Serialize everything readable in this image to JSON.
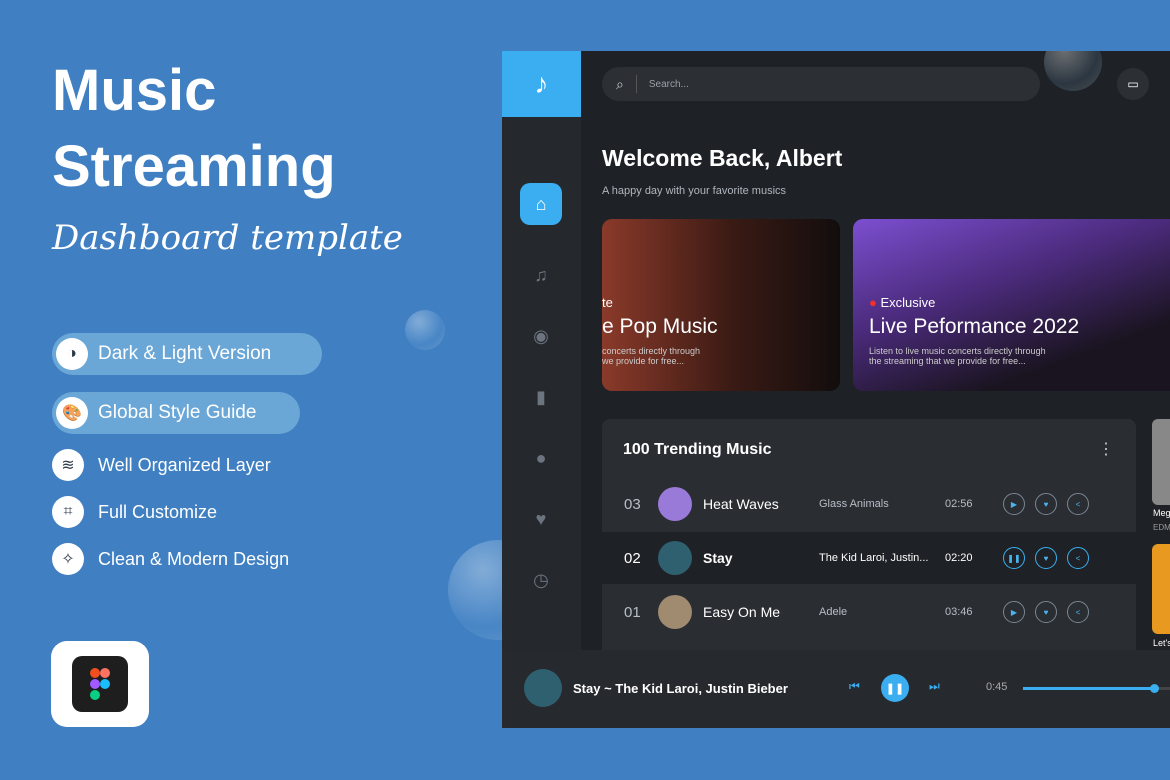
{
  "hero": {
    "title_line1": "Music",
    "title_line2": "Streaming",
    "subtitle": "Dashboard template"
  },
  "features": [
    {
      "label": "Dark & Light Version",
      "icon": "contrast-icon",
      "highlighted": true
    },
    {
      "label": "Global Style Guide",
      "icon": "palette-icon",
      "highlighted": true
    },
    {
      "label": "Well Organized Layer",
      "icon": "layers-icon"
    },
    {
      "label": "Full Customize",
      "icon": "crop-icon"
    },
    {
      "label": "Clean & Modern Design",
      "icon": "magic-wand-icon"
    }
  ],
  "app": {
    "search_placeholder": "Search...",
    "welcome": "Welcome Back, Albert",
    "tagline": "A happy day with your favorite musics",
    "cards": [
      {
        "tag": "te",
        "title": "e Pop Music",
        "desc": "concerts directly through\nwe provide for free..."
      },
      {
        "tag": "Exclusive",
        "title": "Live Peformance 2022",
        "desc": "Listen to live music concerts directly through\nthe streaming that we provide for free..."
      }
    ],
    "trending": {
      "title": "100 Trending Music",
      "rows": [
        {
          "rank": "03",
          "title": "Heat Waves",
          "artist": "Glass Animals",
          "duration": "02:56",
          "playing": false
        },
        {
          "rank": "02",
          "title": "Stay",
          "artist": "The Kid Laroi, Justin...",
          "duration": "02:20",
          "playing": true
        },
        {
          "rank": "01",
          "title": "Easy On Me",
          "artist": "Adele",
          "duration": "03:46",
          "playing": false
        }
      ]
    },
    "side_albums": [
      {
        "title": "Meg",
        "genre": "EDM"
      },
      {
        "title": "Let's"
      }
    ],
    "player": {
      "now_playing": "Stay ~ The Kid Laroi, Justin Bieber",
      "elapsed": "0:45",
      "progress": 0.9
    },
    "accent": "#3aaef0"
  }
}
